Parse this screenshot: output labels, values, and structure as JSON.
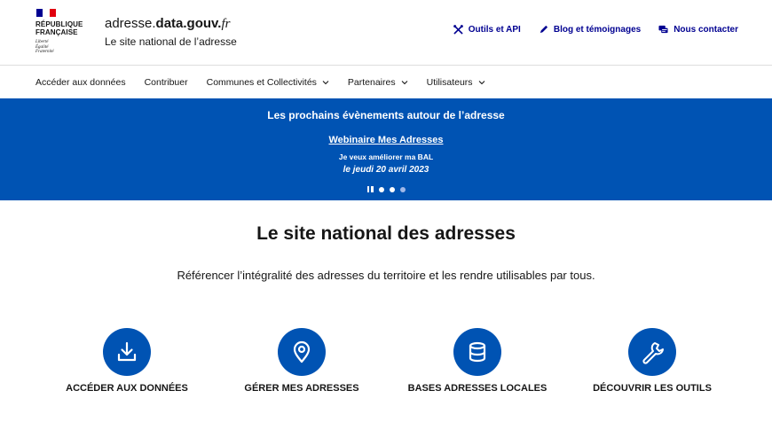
{
  "gov": {
    "name_line1": "RÉPUBLIQUE",
    "name_line2": "FRANÇAISE",
    "motto_line1": "Liberté",
    "motto_line2": "Égalité",
    "motto_line3": "Fraternité"
  },
  "brand": {
    "title_prefix": "adresse.",
    "title_bold": "data.gouv.",
    "title_suffix": "fr",
    "subtitle": "Le site national de l’adresse"
  },
  "tools": [
    {
      "label": "Outils et API",
      "icon": "tools-icon"
    },
    {
      "label": "Blog et témoignages",
      "icon": "pen-icon"
    },
    {
      "label": "Nous contacter",
      "icon": "chat-icon"
    }
  ],
  "nav": [
    {
      "label": "Accéder aux données",
      "dropdown": false
    },
    {
      "label": "Contribuer",
      "dropdown": false
    },
    {
      "label": "Communes et Collectivités",
      "dropdown": true
    },
    {
      "label": "Partenaires",
      "dropdown": true
    },
    {
      "label": "Utilisateurs",
      "dropdown": true
    }
  ],
  "banner": {
    "title": "Les prochains évènements autour de l’adresse",
    "event_title": "Webinaire Mes Adresses",
    "event_desc": "Je veux améliorer ma BAL",
    "event_date": "le jeudi 20 avril 2023"
  },
  "main": {
    "title": "Le site national des adresses",
    "description": "Référencer l’intégralité des adresses du territoire et les rendre utilisables par tous."
  },
  "features": [
    {
      "label": "ACCÉDER AUX DONNÉES",
      "icon": "download-icon"
    },
    {
      "label": "GÉRER MES ADRESSES",
      "icon": "map-pin-icon"
    },
    {
      "label": "BASES ADRESSES LOCALES",
      "icon": "database-icon"
    },
    {
      "label": "DÉCOUVRIR LES OUTILS",
      "icon": "wrench-icon"
    }
  ],
  "colors": {
    "primary": "#000091",
    "banner": "#0053b3",
    "marianne_red": "#e1000f"
  }
}
